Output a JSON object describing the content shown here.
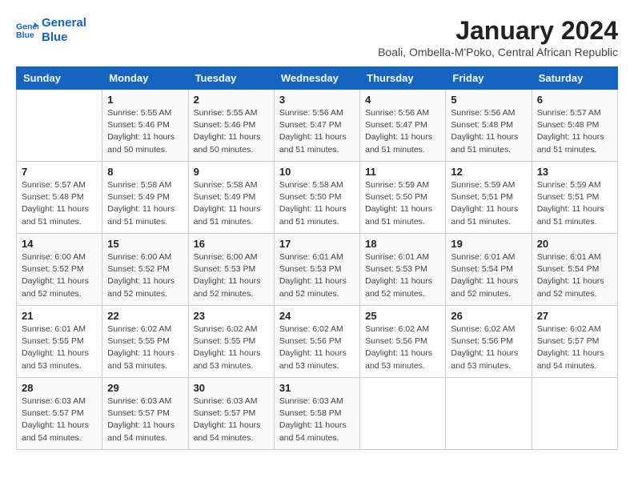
{
  "logo": {
    "line1": "General",
    "line2": "Blue"
  },
  "title": "January 2024",
  "subtitle": "Boali, Ombella-M'Poko, Central African Republic",
  "days_of_week": [
    "Sunday",
    "Monday",
    "Tuesday",
    "Wednesday",
    "Thursday",
    "Friday",
    "Saturday"
  ],
  "weeks": [
    [
      {
        "day": null,
        "info": null
      },
      {
        "day": "1",
        "info": "Sunrise: 5:55 AM\nSunset: 5:46 PM\nDaylight: 11 hours\nand 50 minutes."
      },
      {
        "day": "2",
        "info": "Sunrise: 5:55 AM\nSunset: 5:46 PM\nDaylight: 11 hours\nand 50 minutes."
      },
      {
        "day": "3",
        "info": "Sunrise: 5:56 AM\nSunset: 5:47 PM\nDaylight: 11 hours\nand 51 minutes."
      },
      {
        "day": "4",
        "info": "Sunrise: 5:56 AM\nSunset: 5:47 PM\nDaylight: 11 hours\nand 51 minutes."
      },
      {
        "day": "5",
        "info": "Sunrise: 5:56 AM\nSunset: 5:48 PM\nDaylight: 11 hours\nand 51 minutes."
      },
      {
        "day": "6",
        "info": "Sunrise: 5:57 AM\nSunset: 5:48 PM\nDaylight: 11 hours\nand 51 minutes."
      }
    ],
    [
      {
        "day": "7",
        "info": "Sunrise: 5:57 AM\nSunset: 5:48 PM\nDaylight: 11 hours\nand 51 minutes."
      },
      {
        "day": "8",
        "info": "Sunrise: 5:58 AM\nSunset: 5:49 PM\nDaylight: 11 hours\nand 51 minutes."
      },
      {
        "day": "9",
        "info": "Sunrise: 5:58 AM\nSunset: 5:49 PM\nDaylight: 11 hours\nand 51 minutes."
      },
      {
        "day": "10",
        "info": "Sunrise: 5:58 AM\nSunset: 5:50 PM\nDaylight: 11 hours\nand 51 minutes."
      },
      {
        "day": "11",
        "info": "Sunrise: 5:59 AM\nSunset: 5:50 PM\nDaylight: 11 hours\nand 51 minutes."
      },
      {
        "day": "12",
        "info": "Sunrise: 5:59 AM\nSunset: 5:51 PM\nDaylight: 11 hours\nand 51 minutes."
      },
      {
        "day": "13",
        "info": "Sunrise: 5:59 AM\nSunset: 5:51 PM\nDaylight: 11 hours\nand 51 minutes."
      }
    ],
    [
      {
        "day": "14",
        "info": "Sunrise: 6:00 AM\nSunset: 5:52 PM\nDaylight: 11 hours\nand 52 minutes."
      },
      {
        "day": "15",
        "info": "Sunrise: 6:00 AM\nSunset: 5:52 PM\nDaylight: 11 hours\nand 52 minutes."
      },
      {
        "day": "16",
        "info": "Sunrise: 6:00 AM\nSunset: 5:53 PM\nDaylight: 11 hours\nand 52 minutes."
      },
      {
        "day": "17",
        "info": "Sunrise: 6:01 AM\nSunset: 5:53 PM\nDaylight: 11 hours\nand 52 minutes."
      },
      {
        "day": "18",
        "info": "Sunrise: 6:01 AM\nSunset: 5:53 PM\nDaylight: 11 hours\nand 52 minutes."
      },
      {
        "day": "19",
        "info": "Sunrise: 6:01 AM\nSunset: 5:54 PM\nDaylight: 11 hours\nand 52 minutes."
      },
      {
        "day": "20",
        "info": "Sunrise: 6:01 AM\nSunset: 5:54 PM\nDaylight: 11 hours\nand 52 minutes."
      }
    ],
    [
      {
        "day": "21",
        "info": "Sunrise: 6:01 AM\nSunset: 5:55 PM\nDaylight: 11 hours\nand 53 minutes."
      },
      {
        "day": "22",
        "info": "Sunrise: 6:02 AM\nSunset: 5:55 PM\nDaylight: 11 hours\nand 53 minutes."
      },
      {
        "day": "23",
        "info": "Sunrise: 6:02 AM\nSunset: 5:55 PM\nDaylight: 11 hours\nand 53 minutes."
      },
      {
        "day": "24",
        "info": "Sunrise: 6:02 AM\nSunset: 5:56 PM\nDaylight: 11 hours\nand 53 minutes."
      },
      {
        "day": "25",
        "info": "Sunrise: 6:02 AM\nSunset: 5:56 PM\nDaylight: 11 hours\nand 53 minutes."
      },
      {
        "day": "26",
        "info": "Sunrise: 6:02 AM\nSunset: 5:56 PM\nDaylight: 11 hours\nand 53 minutes."
      },
      {
        "day": "27",
        "info": "Sunrise: 6:02 AM\nSunset: 5:57 PM\nDaylight: 11 hours\nand 54 minutes."
      }
    ],
    [
      {
        "day": "28",
        "info": "Sunrise: 6:03 AM\nSunset: 5:57 PM\nDaylight: 11 hours\nand 54 minutes."
      },
      {
        "day": "29",
        "info": "Sunrise: 6:03 AM\nSunset: 5:57 PM\nDaylight: 11 hours\nand 54 minutes."
      },
      {
        "day": "30",
        "info": "Sunrise: 6:03 AM\nSunset: 5:57 PM\nDaylight: 11 hours\nand 54 minutes."
      },
      {
        "day": "31",
        "info": "Sunrise: 6:03 AM\nSunset: 5:58 PM\nDaylight: 11 hours\nand 54 minutes."
      },
      {
        "day": null,
        "info": null
      },
      {
        "day": null,
        "info": null
      },
      {
        "day": null,
        "info": null
      }
    ]
  ]
}
